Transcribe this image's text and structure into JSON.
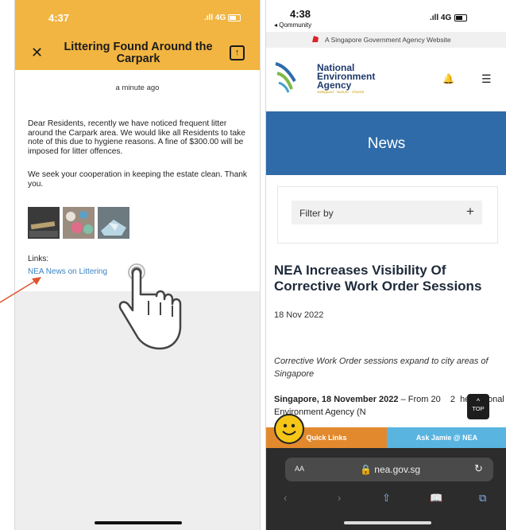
{
  "left_phone": {
    "status_time": "4:37",
    "status_network": "4G",
    "title": "Littering Found Around the Carpark",
    "timestamp": "a minute ago",
    "message_p1": "Dear Residents, recently we have noticed frequent litter around the Carpark area. We would like all Residents to take note of this due to hygiene reasons. A fine of $300.00 will be imposed for litter offences.",
    "message_p2": "We seek your cooperation in keeping the estate clean. Thank you.",
    "links_label": "Links:",
    "link_text": "NEA News on Littering",
    "icons": {
      "close": "close-icon",
      "share": "share-icon",
      "hand": "tap-hand-icon"
    },
    "colors": {
      "header": "#f2b541",
      "link": "#3b82c4",
      "arrow": "#e0532e"
    }
  },
  "right_phone": {
    "status_time": "4:38",
    "back_app": "◂ Qommunity",
    "status_network": "4G",
    "gov_banner": "A Singapore Government Agency Website",
    "agency_name": "National Environment Agency",
    "agency_tagline": "Safeguard · Nurture · Cherish",
    "section_title": "News",
    "filter_label": "Filter by",
    "filter_plus": "+",
    "headline": "NEA Increases Visibility Of Corrective Work Order Sessions",
    "date": "18 Nov 2022",
    "summary": "Corrective Work Order sessions expand to city areas of Singapore",
    "body_bold": "Singapore, 18 November 2022",
    "body_rest": " – From 20    2  he National Environment Agency (N",
    "top_label": "TOP",
    "quick_links": "Quick Links",
    "ask_jamie": "Ask Jamie @ NEA",
    "aa_label": "AA",
    "url": "nea.gov.sg",
    "colors": {
      "news_band": "#2f6ba8",
      "quick_links": "#e2892e",
      "ask_jamie": "#59b4e0"
    }
  }
}
